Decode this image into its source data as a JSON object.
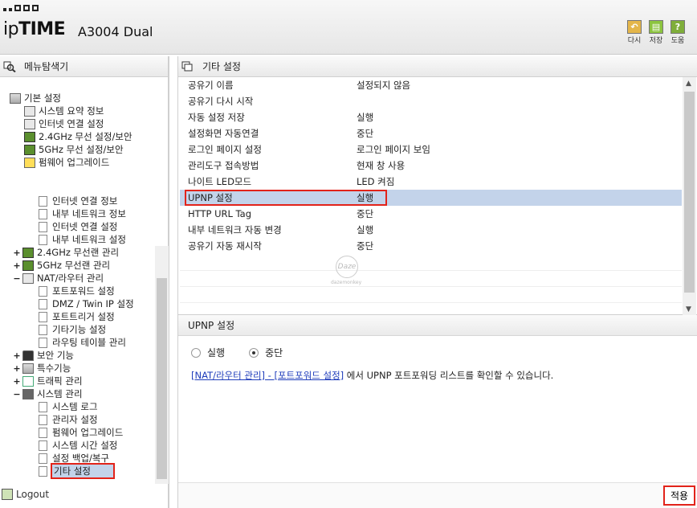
{
  "header": {
    "brand_a": "ip",
    "brand_b": "TIME",
    "model": "A3004 Dual",
    "buttons": [
      {
        "label": "다시",
        "color": "#e4b64a",
        "icon": "undo-icon"
      },
      {
        "label": "저장",
        "color": "#8cc43f",
        "icon": "save-icon"
      },
      {
        "label": "도움",
        "color": "#7fae3a",
        "icon": "help-icon",
        "glyph": "?"
      }
    ]
  },
  "sidebar": {
    "title": "메뉴탐색기",
    "items": [
      {
        "label": "기본 설정"
      },
      {
        "label": "시스템 요약 정보"
      },
      {
        "label": "인터넷 연결 설정"
      },
      {
        "label": "2.4GHz 무선 설정/보안"
      },
      {
        "label": "5GHz 무선 설정/보안"
      },
      {
        "label": "펌웨어 업그레이드"
      },
      {
        "label": "인터넷 연결 정보"
      },
      {
        "label": "내부 네트워크 정보"
      },
      {
        "label": "인터넷 연결 설정"
      },
      {
        "label": "내부 네트워크 설정"
      },
      {
        "label": "2.4GHz 무선랜 관리",
        "exp": "+"
      },
      {
        "label": "5GHz 무선랜 관리",
        "exp": "+"
      },
      {
        "label": "NAT/라우터 관리",
        "exp": "−"
      },
      {
        "label": "포트포워드 설정"
      },
      {
        "label": "DMZ / Twin IP 설정"
      },
      {
        "label": "포트트리거 설정"
      },
      {
        "label": "기타기능 설정"
      },
      {
        "label": "라우팅 테이블 관리"
      },
      {
        "label": "보안 기능",
        "exp": "+"
      },
      {
        "label": "특수기능",
        "exp": "+"
      },
      {
        "label": "트래픽 관리",
        "exp": "+"
      },
      {
        "label": "시스템 관리",
        "exp": "−"
      },
      {
        "label": "시스템 로그"
      },
      {
        "label": "관리자 설정"
      },
      {
        "label": "펌웨어 업그레이드"
      },
      {
        "label": "시스템 시간 설정"
      },
      {
        "label": "설정 백업/복구"
      },
      {
        "label": "기타 설정"
      }
    ],
    "logout": "Logout"
  },
  "main": {
    "title": "기타 설정",
    "rows": [
      {
        "key": "공유기 이름",
        "value": "설정되지 않음"
      },
      {
        "key": "공유기 다시 시작",
        "value": ""
      },
      {
        "key": "자동 설정 저장",
        "value": "실행"
      },
      {
        "key": "설정화면 자동연결",
        "value": "중단"
      },
      {
        "key": "로그인 페이지 설정",
        "value": "로그인 페이지 보임"
      },
      {
        "key": "관리도구 접속방법",
        "value": "현재 창 사용"
      },
      {
        "key": "나이트 LED모드",
        "value": "LED 켜짐"
      },
      {
        "key": "UPNP 설정",
        "value": "실행"
      },
      {
        "key": "HTTP URL Tag",
        "value": "중단"
      },
      {
        "key": "내부 네트워크 자동 변경",
        "value": "실행"
      },
      {
        "key": "공유기 자동 재시작",
        "value": "중단"
      }
    ],
    "detail": {
      "title": "UPNP 설정",
      "option_on": "실행",
      "option_off": "중단",
      "selected": "중단",
      "link": "[NAT/라우터 관리] - [포트포워드 설정]",
      "info": " 에서 UPNP 포트포워딩 리스트를 확인할 수 있습니다."
    },
    "apply": "적용"
  },
  "watermark": {
    "mark": "Daze",
    "label": "dazemonkey"
  }
}
